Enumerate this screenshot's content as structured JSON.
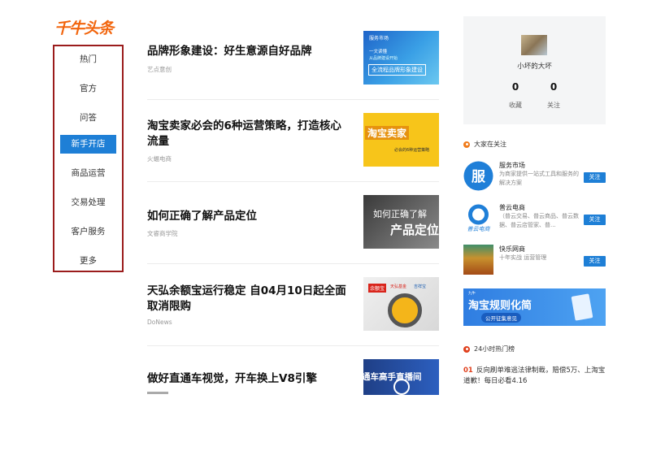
{
  "logo": {
    "text": "千牛头条",
    "color": "#f2650d"
  },
  "nav": {
    "items": [
      {
        "label": "热门"
      },
      {
        "label": "官方"
      },
      {
        "label": "问答"
      },
      {
        "label": "新手开店",
        "active": true
      },
      {
        "label": "商品运营"
      },
      {
        "label": "交易处理"
      },
      {
        "label": "客户服务"
      },
      {
        "label": "更多"
      }
    ],
    "active_color": "#1e7fd6",
    "border_color": "#9b1c1c"
  },
  "feed": [
    {
      "title": "品牌形象建设：好生意源自好品牌",
      "source": "艺点意创",
      "thumb": {
        "lines": [
          "服务市场",
          "一文读懂",
          "从品牌建设开始",
          "全流程品牌形象建设"
        ]
      }
    },
    {
      "title": "淘宝卖家必会的6种运营策略，打造核心流量",
      "source": "火蝠电商",
      "thumb": {
        "lines": [
          "淘宝卖家",
          "必会的6种运营策略"
        ]
      }
    },
    {
      "title": "如何正确了解产品定位",
      "source": "文睿商学院",
      "thumb": {
        "lines": [
          "如何正确了解",
          "产品定位"
        ]
      }
    },
    {
      "title": "天弘余额宝运行稳定 自04月10日起全面取消限购",
      "source": "DoNews",
      "thumb": {
        "lines": [
          "余额宝",
          "天弘基金",
          "吉祥宝"
        ]
      }
    },
    {
      "title": "做好直通车视觉，开车换上V8引擎",
      "source": "",
      "thumb": {
        "lines": [
          "通车高手直播间"
        ]
      }
    }
  ],
  "profile": {
    "name": "小坏的大坏",
    "stats": [
      {
        "value": "0",
        "label": "收藏"
      },
      {
        "value": "0",
        "label": "关注"
      }
    ]
  },
  "following": {
    "heading": "大家在关注",
    "items": [
      {
        "name": "服务市场",
        "desc": "为商家提供一站式工具和服务的解决方案",
        "button": "关注",
        "icon": "service-market-logo"
      },
      {
        "name": "普云电商",
        "desc": "（普云交易、普云商品、普云数据、普云店管家、普...",
        "button": "关注",
        "icon": "puyun-logo"
      },
      {
        "name": "快乐网商",
        "desc": "十年实战 运营管理",
        "button": "关注",
        "icon": "kuaile-logo"
      }
    ]
  },
  "banner": {
    "title": "淘宝规则化简",
    "subtitle": "公开征集意见",
    "tag": "九牛"
  },
  "hot": {
    "heading": "24小时热门榜",
    "items": [
      {
        "rank": "01",
        "text": "反向刷单难逃法律制裁，赔偿5万、上淘宝道歉！每日必看4.16"
      }
    ]
  }
}
